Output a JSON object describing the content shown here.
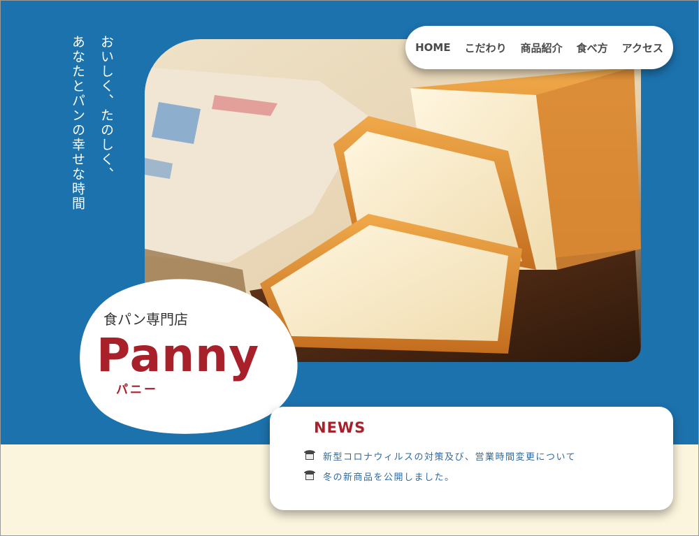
{
  "tagline": {
    "line1": "おいしく、たのしく、",
    "line2": "あなたとパンの幸せな時間"
  },
  "nav": {
    "items": [
      "HOME",
      "こだわり",
      "商品紹介",
      "食べ方",
      "アクセス"
    ]
  },
  "logo": {
    "subtitle": "食パン専門店",
    "name": "Panny",
    "kana": "パニー"
  },
  "news": {
    "title": "NEWS",
    "items": [
      {
        "text": "新型コロナウィルスの対策及び、営業時間変更について",
        "icon": "bread-icon"
      },
      {
        "text": "冬の新商品を公開しました。",
        "icon": "bread-icon"
      }
    ]
  },
  "colors": {
    "blue": "#1c72ad",
    "cream": "#fbf5dd",
    "brand_red": "#a8202a",
    "link_blue": "#2f6aa3"
  }
}
